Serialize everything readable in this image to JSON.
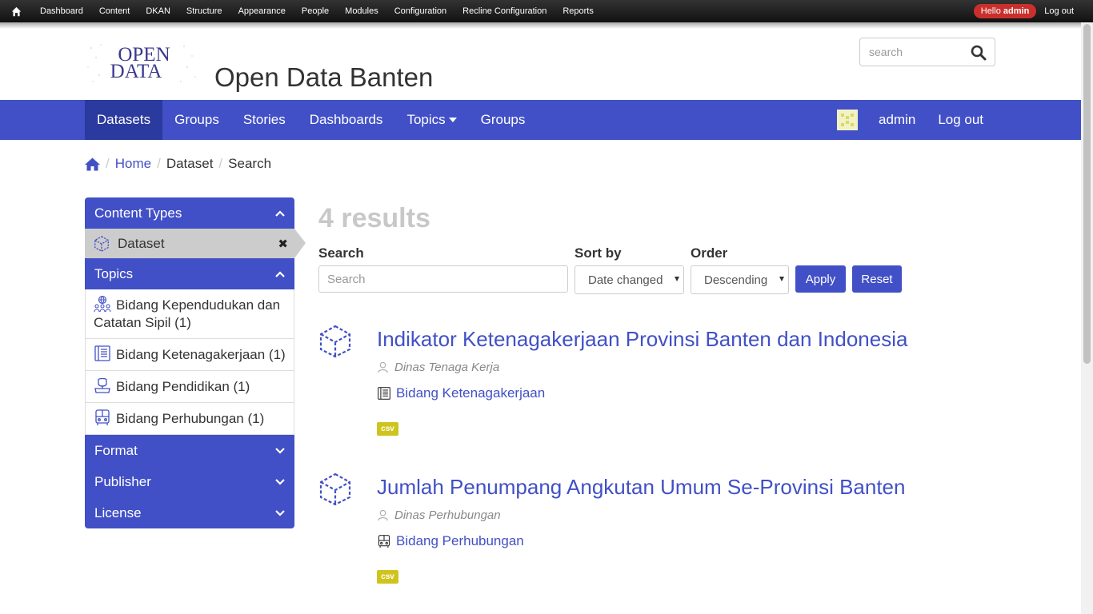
{
  "admin_toolbar": {
    "items": [
      "Dashboard",
      "Content",
      "DKAN",
      "Structure",
      "Appearance",
      "People",
      "Modules",
      "Configuration",
      "Recline Configuration",
      "Reports"
    ],
    "hello_prefix": "Hello",
    "hello_user": "admin",
    "logout": "Log out"
  },
  "header": {
    "logo_line1": "OPEN",
    "logo_line2": "DATA",
    "site_name": "Open Data Banten",
    "search_placeholder": "search"
  },
  "nav": {
    "items": [
      {
        "label": "Datasets",
        "active": true
      },
      {
        "label": "Groups"
      },
      {
        "label": "Stories"
      },
      {
        "label": "Dashboards"
      },
      {
        "label": "Topics",
        "dropdown": true
      },
      {
        "label": "Groups"
      }
    ],
    "user_name": "admin",
    "logout": "Log out"
  },
  "breadcrumb": {
    "home": "Home",
    "dataset": "Dataset",
    "current": "Search"
  },
  "facets": {
    "content_types": {
      "title": "Content Types",
      "active": "Dataset"
    },
    "topics": {
      "title": "Topics",
      "items": [
        {
          "label": "Bidang Kependudukan dan Catatan Sipil (1)",
          "icon": "population-icon"
        },
        {
          "label": "Bidang Ketenagakerjaan (1)",
          "icon": "book-icon"
        },
        {
          "label": "Bidang Pendidikan (1)",
          "icon": "education-icon"
        },
        {
          "label": "Bidang Perhubungan (1)",
          "icon": "bus-icon"
        }
      ]
    },
    "format": {
      "title": "Format"
    },
    "publisher": {
      "title": "Publisher"
    },
    "license": {
      "title": "License"
    }
  },
  "results": {
    "count_text": "4 results",
    "form": {
      "search_label": "Search",
      "search_placeholder": "Search",
      "sort_label": "Sort by",
      "sort_value": "Date changed",
      "order_label": "Order",
      "order_value": "Descending",
      "apply": "Apply",
      "reset": "Reset"
    },
    "items": [
      {
        "title": "Indikator Ketenagakerjaan Provinsi Banten dan Indonesia",
        "publisher": "Dinas Tenaga Kerja",
        "topic": "Bidang Ketenagakerjaan",
        "topic_icon": "book-icon",
        "format": "csv"
      },
      {
        "title": "Jumlah Penumpang Angkutan Umum Se-Provinsi Banten",
        "publisher": "Dinas Perhubungan",
        "topic": "Bidang Perhubungan",
        "topic_icon": "bus-icon",
        "format": "csv"
      }
    ]
  },
  "colors": {
    "primary": "#4150c6",
    "primary_dark": "#2b3a9e",
    "badge_csv": "#cfc41d",
    "hello_pill": "#c9302c"
  }
}
